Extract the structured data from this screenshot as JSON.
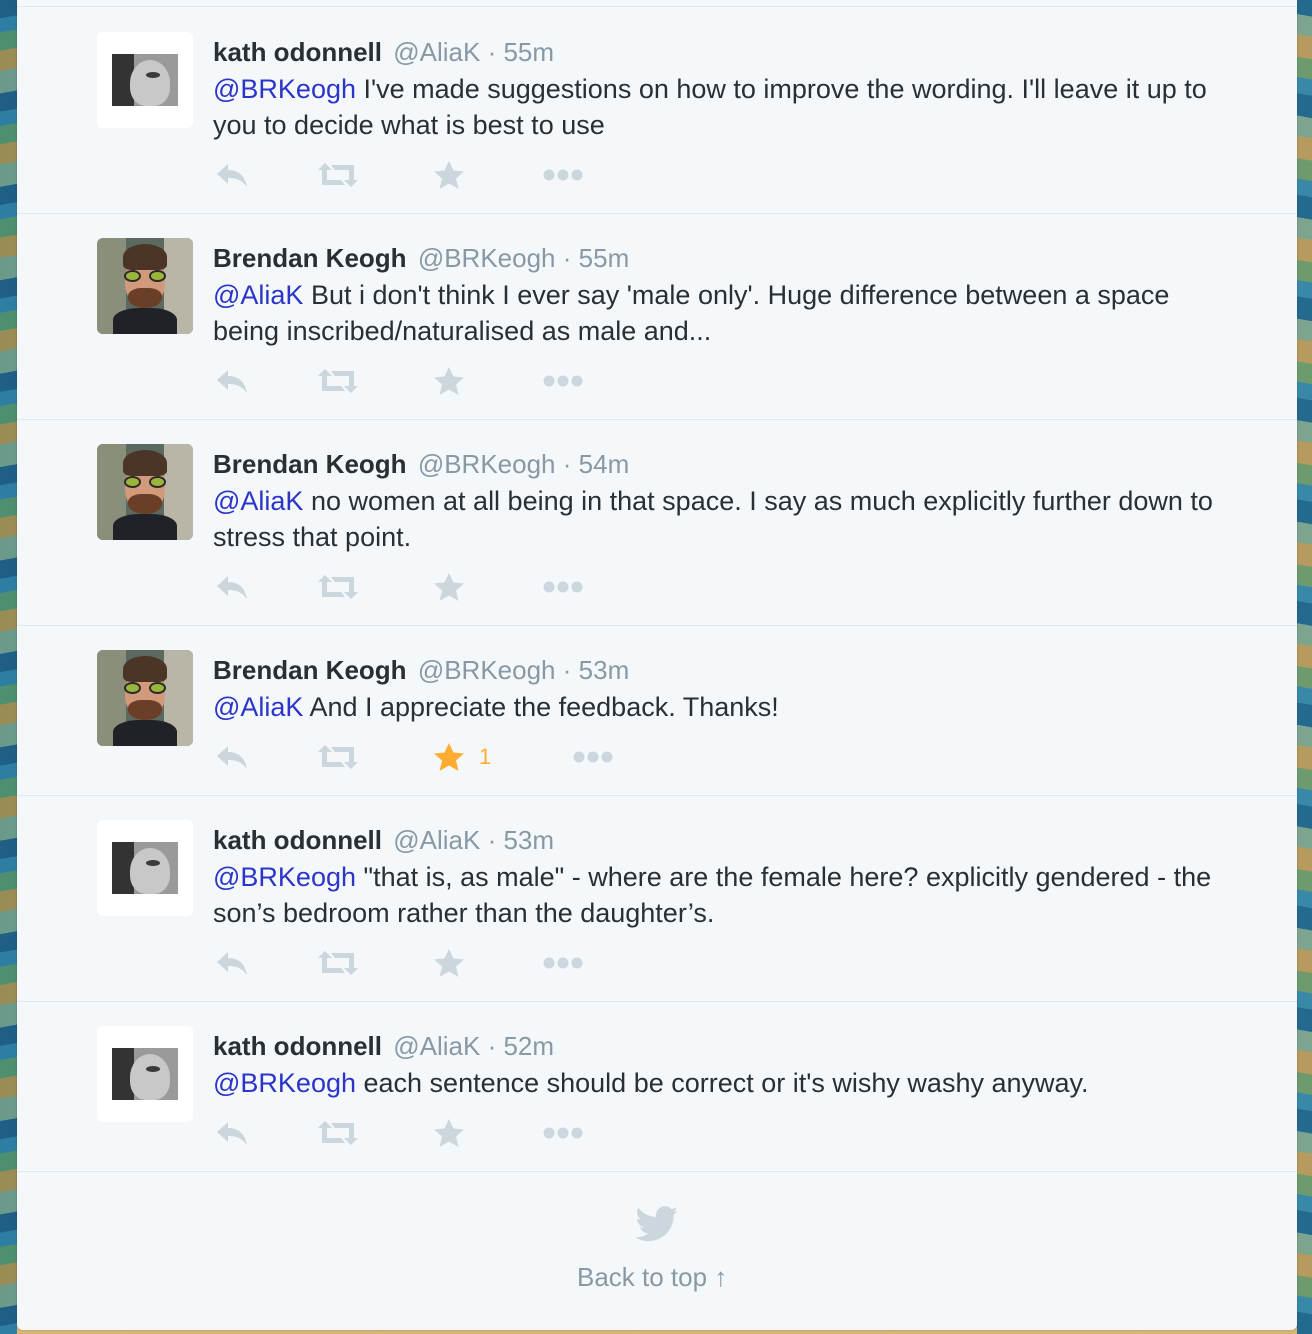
{
  "colors": {
    "mention": "#2c35c9",
    "muted": "#8899a6",
    "text": "#292f33",
    "icon": "#ccd6dd",
    "favorited": "#ffac33",
    "stream_bg": "#f5f8fa"
  },
  "tweets": [
    {
      "name": "kath odonnell",
      "handle": "@AliaK",
      "time": "55m",
      "mention": "@BRKeogh",
      "text": " I've made suggestions on how to improve the wording. I'll leave it up to you to decide what is best to use"
    },
    {
      "name": "Brendan Keogh",
      "handle": "@BRKeogh",
      "time": "55m",
      "mention": "@AliaK",
      "text": " But i don't think I ever say 'male only'. Huge difference between a space being inscribed/naturalised as male and..."
    },
    {
      "name": "Brendan Keogh",
      "handle": "@BRKeogh",
      "time": "54m",
      "mention": "@AliaK",
      "text": " no women at all being in that space. I say as much explicitly further down to stress that point."
    },
    {
      "name": "Brendan Keogh",
      "handle": "@BRKeogh",
      "time": "53m",
      "mention": "@AliaK",
      "text": " And I appreciate the feedback. Thanks!",
      "favorites": "1"
    },
    {
      "name": "kath odonnell",
      "handle": "@AliaK",
      "time": "53m",
      "mention": "@BRKeogh",
      "text": " \"that is, as male\" - where are the female here? explicitly gendered - the son’s bedroom rather than the daughter’s."
    },
    {
      "name": "kath odonnell",
      "handle": "@AliaK",
      "time": "52m",
      "mention": "@BRKeogh",
      "text": " each sentence should be correct or it's wishy washy anyway."
    }
  ],
  "icons": {
    "reply": "reply-icon",
    "retweet": "retweet-icon",
    "favorite": "star-icon",
    "more": "more-icon",
    "footer": "twitter-bird-icon"
  },
  "footer": {
    "back_to_top": "Back to top ↑"
  }
}
